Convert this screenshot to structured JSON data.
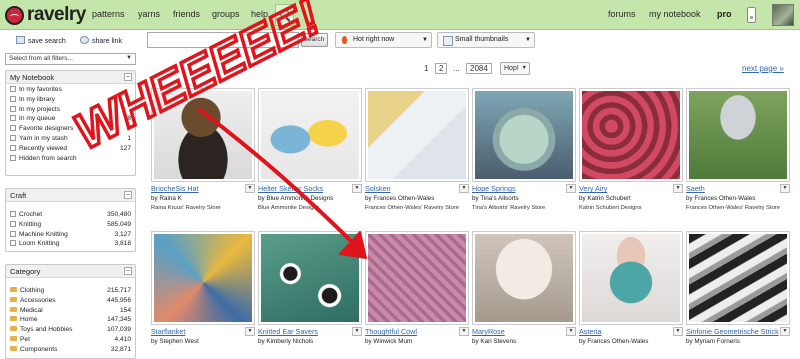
{
  "topbar": {
    "logo_text": "ravelry",
    "nav": [
      "patterns",
      "yarns",
      "friends",
      "groups",
      "help"
    ],
    "right_nav": [
      "forums",
      "my notebook"
    ],
    "pro": "pro",
    "icons": {
      "search": "search-icon",
      "messages": "message-icon",
      "avatar": "avatar"
    }
  },
  "toolbar": {
    "save_search": "save search",
    "share_link": "share link",
    "search_placeholder": "",
    "search_button": "search",
    "sort_select": "Hot right now",
    "view_select": "Small thumbnails",
    "filter_select": "Select from all filters..."
  },
  "pager": {
    "page1": "1",
    "page2": "2",
    "dots": "...",
    "last": "2084",
    "hop": "Hop!",
    "next": "next page »"
  },
  "sidebar": {
    "notebook": {
      "title": "My Notebook",
      "items": [
        {
          "label": "In my favorites",
          "count": ""
        },
        {
          "label": "In my library",
          "count": ""
        },
        {
          "label": "In my projects",
          "count": ""
        },
        {
          "label": "In my queue",
          "count": "8"
        },
        {
          "label": "Favorite designers",
          "count": ""
        },
        {
          "label": "Yarn in my stash",
          "count": "1"
        },
        {
          "label": "Recently viewed",
          "count": "127"
        },
        {
          "label": "Hidden from search",
          "count": ""
        }
      ]
    },
    "craft": {
      "title": "Craft",
      "items": [
        {
          "label": "Crochet",
          "count": "350,480"
        },
        {
          "label": "Knitting",
          "count": "585,049"
        },
        {
          "label": "Machine Knitting",
          "count": "3,127"
        },
        {
          "label": "Loom Knitting",
          "count": "3,818"
        }
      ]
    },
    "category": {
      "title": "Category",
      "items": [
        {
          "label": "Clothing",
          "count": "215,717"
        },
        {
          "label": "Accessories",
          "count": "445,956"
        },
        {
          "label": "Medical",
          "count": "154"
        },
        {
          "label": "Home",
          "count": "147,345"
        },
        {
          "label": "Toys and Hobbies",
          "count": "107,039"
        },
        {
          "label": "Pet",
          "count": "4,410"
        },
        {
          "label": "Components",
          "count": "32,871"
        }
      ]
    }
  },
  "patterns_row1": [
    {
      "title": "BriocheSis Hat",
      "by": "by Raina K",
      "shop": "Raina Kruus' Ravelry Store"
    },
    {
      "title": "Helter Skelter Socks",
      "by": "by Blue Ammonite Designs",
      "shop": "Blue Ammonite Designs"
    },
    {
      "title": "Solsken",
      "by": "by Frances Othen-Wales",
      "shop": "Frances Othen-Wales' Ravelry Store"
    },
    {
      "title": "Hope Springs",
      "by": "by Tina's Allsorts",
      "shop": "Tina's Allsorts' Ravelry Store"
    },
    {
      "title": "Very Airy",
      "by": "by Katrin Schubert",
      "shop": "Katrin Schubert Designs"
    },
    {
      "title": "Saeth",
      "by": "by Frances Othen-Wales",
      "shop": "Frances Othen-Wales' Ravelry Store"
    }
  ],
  "patterns_row2": [
    {
      "title": "Starflanket",
      "by": "by Stephen West"
    },
    {
      "title": "Knitted Ear Savers",
      "by": "by Kimberly Nichols"
    },
    {
      "title": "Thoughtful Cowl",
      "by": "by Winwick Mum"
    },
    {
      "title": "MaryRose",
      "by": "by Kari Stevens"
    },
    {
      "title": "Asteria",
      "by": "by Frances Othen-Wales"
    },
    {
      "title": "Sinfonie Geometrische Strick",
      "by": "by Myriam Forneris"
    }
  ],
  "overlay": {
    "text": "WHEEEEE!",
    "color": "#e0141b"
  },
  "colors": {
    "topbar": "#c4e6aa",
    "link": "#3366aa",
    "accent": "#e0141b"
  }
}
